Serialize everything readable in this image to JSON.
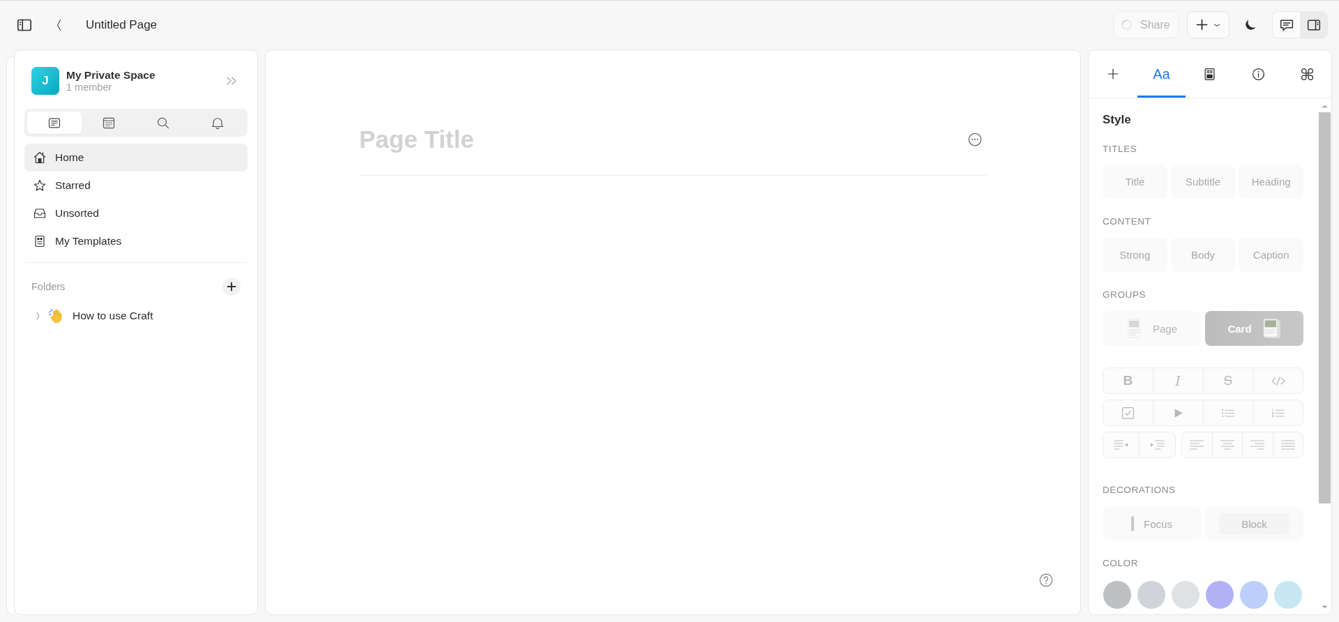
{
  "top_bar": {
    "title": "Untitled Page",
    "share_button": {
      "label": "Share",
      "disabled": true
    },
    "pane_toggles": [
      {
        "kind": "comments",
        "selected": false
      },
      {
        "kind": "inspector",
        "selected": true
      }
    ]
  },
  "sidebar": {
    "space": {
      "initial": "J",
      "name": "My Private Space",
      "members": "1 member"
    },
    "tabs": [
      {
        "kind": "documents",
        "selected": true
      },
      {
        "kind": "calendar",
        "selected": false
      },
      {
        "kind": "search",
        "selected": false
      },
      {
        "kind": "notifications",
        "selected": false
      }
    ],
    "items": [
      {
        "kind": "home",
        "label": "Home",
        "selected": true
      },
      {
        "kind": "starred",
        "label": "Starred",
        "selected": false
      },
      {
        "kind": "unsorted",
        "label": "Unsorted",
        "selected": false
      },
      {
        "kind": "templates",
        "label": "My Templates",
        "selected": false
      }
    ],
    "folders": {
      "heading": "Folders",
      "items": [
        {
          "label": "How to use Craft",
          "expanded": false
        }
      ]
    }
  },
  "page": {
    "title": {
      "placeholder": "Page Title"
    }
  },
  "inspector": {
    "tabs": [
      {
        "kind": "insert",
        "selected": false
      },
      {
        "kind": "style",
        "label": "Aa",
        "selected": true
      },
      {
        "kind": "document",
        "selected": false
      },
      {
        "kind": "info",
        "selected": false
      },
      {
        "kind": "shortcuts",
        "selected": false
      }
    ],
    "heading": "Style",
    "titles": {
      "heading": "TITLES",
      "buttons": [
        {
          "label": "Title",
          "disabled": true
        },
        {
          "label": "Subtitle",
          "disabled": true
        },
        {
          "label": "Heading",
          "disabled": true
        }
      ]
    },
    "content": {
      "heading": "CONTENT",
      "buttons": [
        {
          "label": "Strong",
          "disabled": true
        },
        {
          "label": "Body",
          "disabled": true
        },
        {
          "label": "Caption",
          "disabled": true
        }
      ]
    },
    "groups": {
      "heading": "GROUPS",
      "buttons": [
        {
          "kind": "page",
          "label": "Page",
          "selected": false
        },
        {
          "kind": "card",
          "label": "Card",
          "selected": true
        }
      ]
    },
    "format_toolbar": {
      "rows": [
        {
          "groups": [
            {
              "buttons": [
                {
                  "kind": "bold",
                  "label": "B",
                  "disabled": true
                },
                {
                  "kind": "italic",
                  "label": "I",
                  "disabled": true
                },
                {
                  "kind": "strike",
                  "label": "S",
                  "disabled": true
                },
                {
                  "kind": "code",
                  "disabled": true
                }
              ]
            }
          ]
        },
        {
          "groups": [
            {
              "buttons": [
                {
                  "kind": "checkbox",
                  "disabled": true
                },
                {
                  "kind": "play",
                  "disabled": true
                },
                {
                  "kind": "bullets",
                  "disabled": true
                },
                {
                  "kind": "numbers",
                  "disabled": true
                }
              ]
            }
          ]
        },
        {
          "groups": [
            {
              "buttons": [
                {
                  "kind": "outdent",
                  "disabled": true
                },
                {
                  "kind": "indent",
                  "disabled": true
                }
              ]
            },
            {
              "buttons": [
                {
                  "kind": "align-left",
                  "disabled": true
                },
                {
                  "kind": "align-center",
                  "disabled": true
                },
                {
                  "kind": "align-right",
                  "disabled": true
                },
                {
                  "kind": "justify",
                  "disabled": true
                }
              ]
            }
          ]
        }
      ]
    },
    "decorations": {
      "heading": "DECORATIONS",
      "buttons": [
        {
          "kind": "focus",
          "label": "Focus",
          "disabled": true
        },
        {
          "kind": "block",
          "label": "Block",
          "disabled": true
        }
      ]
    },
    "color": {
      "heading": "COLOR",
      "swatches": [
        {
          "color": "#bfc0c1"
        },
        {
          "color": "#d0d3d8"
        },
        {
          "color": "#e0e1e3"
        },
        {
          "color": "#b3b1f6"
        },
        {
          "color": "#bccffa"
        },
        {
          "color": "#c8e7f3"
        }
      ]
    }
  }
}
